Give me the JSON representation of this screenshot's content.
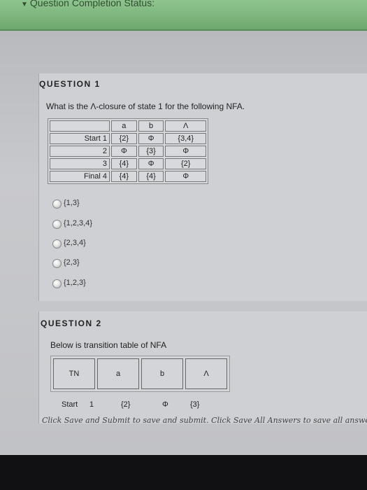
{
  "banner": {
    "label": "Question Completion Status:"
  },
  "question1": {
    "heading": "QUESTION 1",
    "prompt": "What is the Λ-closure of state 1 for the following NFA.",
    "table": {
      "headers": [
        "",
        "a",
        "b",
        "Λ"
      ],
      "rows": [
        [
          "Start  1",
          "{2}",
          "Φ",
          "{3,4}"
        ],
        [
          "2",
          "Φ",
          "{3}",
          "Φ"
        ],
        [
          "3",
          "{4}",
          "Φ",
          "{2}"
        ],
        [
          "Final  4",
          "{4}",
          "{4}",
          "Φ"
        ]
      ]
    },
    "options": [
      "{1,3}",
      "{1,2,3,4}",
      "{2,3,4}",
      "{2,3}",
      "{1,2,3}"
    ]
  },
  "question2": {
    "heading": "QUESTION 2",
    "prompt": "Below is transition table of NFA",
    "table": {
      "headers": [
        "TN",
        "a",
        "b",
        "Λ"
      ],
      "row1": [
        "Start",
        "1",
        "{2}",
        "Φ",
        "{3}"
      ]
    }
  },
  "footer": {
    "hint": "Click Save and Submit to save and submit. Click Save All Answers to save all answers"
  }
}
